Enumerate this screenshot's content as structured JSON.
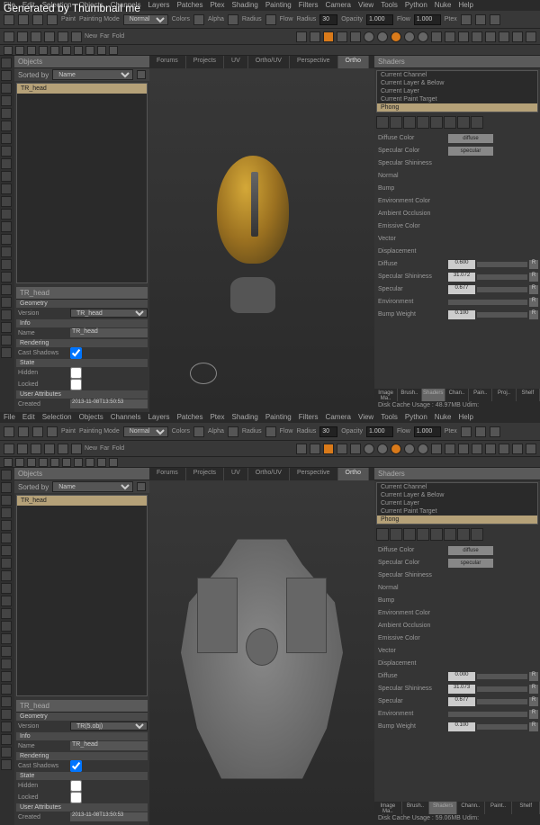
{
  "watermark": "Generated by Thumbnail me",
  "menu": [
    "File",
    "Edit",
    "Selection",
    "Objects",
    "Channels",
    "Layers",
    "Patches",
    "Ptex",
    "Shading",
    "Painting",
    "Filters",
    "Camera",
    "View",
    "Tools",
    "Python",
    "Nuke",
    "Help"
  ],
  "toolbar1": {
    "paint": "Paint",
    "paintmode": "Painting Mode",
    "paintmode_val": "Normal",
    "colors": "Colors",
    "alpha": "Alpha",
    "radius": "Radius",
    "flow_lbl": "Flow",
    "radius_lbl": "Radius",
    "radius_val": "0",
    "radius2_val": "30",
    "opacity": "Opacity",
    "opacity_val": "1.000",
    "flow": "Flow",
    "flow_val": "1.000",
    "ptex": "Ptex"
  },
  "toolbar2": {
    "new": "New",
    "far": "Far",
    "fold": "Fold"
  },
  "objects": {
    "title": "Objects",
    "sortby": "Sorted by",
    "sortval": "Name",
    "item": "TR_head"
  },
  "props": {
    "header": "TR_head",
    "geometry": "Geometry",
    "version": "Version",
    "version_val": "TR_head",
    "version_val2": "TR(5.obj)",
    "info": "Info",
    "name": "Name",
    "name_val": "TR_head",
    "rendering": "Rendering",
    "castshadows": "Cast Shadows",
    "state": "State",
    "hidden": "Hidden",
    "locked": "Locked",
    "userattr": "User Attributes",
    "created": "Created",
    "created_val": "2013-11-08T13:50:53"
  },
  "viewport": {
    "tabs": [
      "Forums",
      "Projects",
      "UV",
      "Ortho/UV",
      "Perspective",
      "Ortho"
    ]
  },
  "shaders": {
    "title": "Shaders",
    "items": [
      "Current Channel",
      "Current Layer & Below",
      "Current Layer",
      "Current Paint Target",
      "Phong"
    ],
    "diffuse_color": "Diffuse Color",
    "diffuse": "diffuse",
    "specular_color": "Specular Color",
    "specular": "specular",
    "specular_shininess": "Specular Shininess",
    "normal": "Normal",
    "bump": "Bump",
    "env_color": "Environment Color",
    "ambient_occ": "Ambient Occlusion",
    "emissive_color": "Emissive Color",
    "vector": "Vector",
    "displacement": "Displacement",
    "diffuse_lbl": "Diffuse",
    "diffuse_val": "0.600",
    "diffuse_val2": "0.000",
    "spec_shine_lbl": "Specular Shininess",
    "spec_shine_val": "31.072",
    "spec_shine_val2": "31.073",
    "specular_lbl": "Specular",
    "specular_val": "0.677",
    "environment": "Environment",
    "bump_weight": "Bump Weight",
    "bump_val": "0.100",
    "r": "R"
  },
  "bottom_tabs": [
    "Image Ma..",
    "Brush..",
    "Shaders",
    "Chan..",
    "Pain..",
    "Proj..",
    "Shelf"
  ],
  "bottom_tabs2": [
    "Image Ma..",
    "Brush..",
    "Shaders",
    "Chann..",
    "Paint..",
    "Shelf"
  ],
  "status1": "Disk Cache Usage : 48.97MB  Udim:",
  "status2": "Disk Cache Usage : 59.06MB  Udim:"
}
